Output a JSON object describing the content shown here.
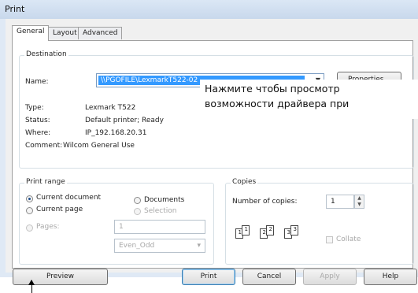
{
  "window": {
    "title": "Print"
  },
  "tabs": [
    {
      "label": "General"
    },
    {
      "label": "Layout"
    },
    {
      "label": "Advanced"
    }
  ],
  "destination": {
    "legend": "Destination",
    "name_label": "Name:",
    "name_value": "\\\\PGOFILE\\LexmarkT522-02",
    "properties_label": "Properties...",
    "type_label": "Type:",
    "type_value": "Lexmark T522",
    "status_label": "Status:",
    "status_value": "Default printer; Ready",
    "where_label": "Where:",
    "where_value": "IP_192.168.20.31",
    "comment_label": "Comment:",
    "comment_value": "Wilcom General Use"
  },
  "tooltip": {
    "line1": "Нажмите   чтобы просмотр",
    "line2": "возможности драйвера при"
  },
  "print_range": {
    "legend": "Print range",
    "current_document": "Current document",
    "documents": "Documents",
    "current_page": "Current page",
    "selection": "Selection",
    "pages_label": "Pages:",
    "pages_value": "1",
    "even_odd": "Even_Odd"
  },
  "copies": {
    "legend": "Copies",
    "number_label": "Number of copies:",
    "number_value": "1",
    "collate_label": "Collate",
    "pages_icon": [
      "1",
      "1",
      "2",
      "2",
      "3",
      "3"
    ]
  },
  "footer": {
    "preview": "Preview",
    "print": "Print",
    "cancel": "Cancel",
    "apply": "Apply",
    "help": "Help"
  },
  "colors": {
    "selection": "#3399ff",
    "title_bar": "#c8d8ec"
  }
}
